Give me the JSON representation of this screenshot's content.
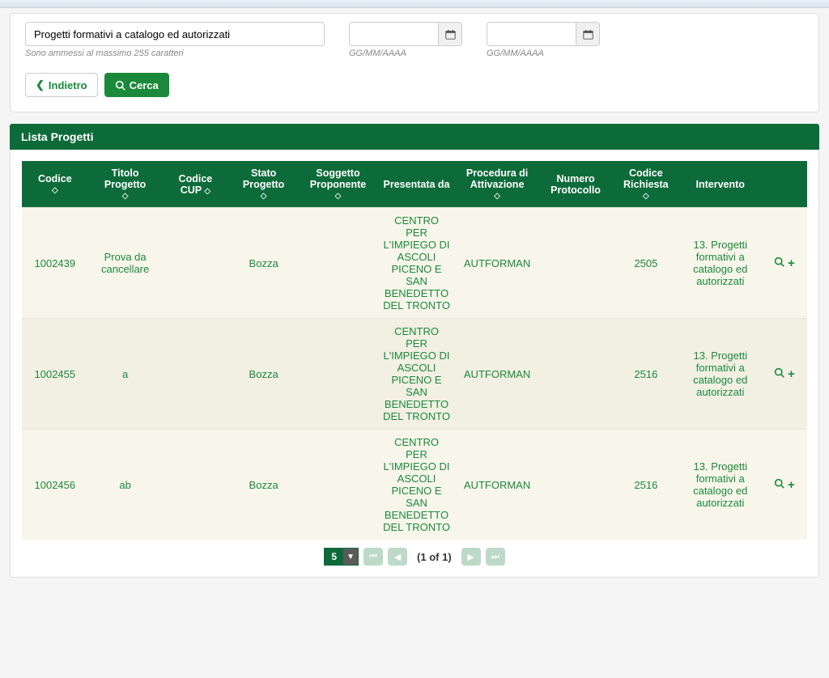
{
  "search": {
    "text_value": "Progetti formativi a catalogo ed autorizzati",
    "text_helper": "Sono ammessi al massimo 255 caratteri",
    "date_helper": "GG/MM/AAAA",
    "btn_back": "Indietro",
    "btn_search": "Cerca"
  },
  "list": {
    "title": "Lista Progetti",
    "headers": {
      "codice": "Codice",
      "titolo": "Titolo Progetto",
      "cup": "Codice CUP",
      "stato": "Stato Progetto",
      "soggetto": "Soggetto Proponente",
      "presentata": "Presentata da",
      "procedura": "Procedura di Attivazione",
      "protocollo": "Numero Protocollo",
      "richiesta": "Codice Richiesta",
      "intervento": "Intervento"
    },
    "rows": [
      {
        "codice": "1002439",
        "titolo": "Prova da cancellare",
        "cup": "",
        "stato": "Bozza",
        "soggetto": "",
        "presentata": "CENTRO PER L'IMPIEGO DI ASCOLI PICENO E SAN BENEDETTO DEL TRONTO",
        "procedura": "AUTFORMAN",
        "protocollo": "",
        "richiesta": "2505",
        "intervento": "13. Progetti formativi a catalogo ed autorizzati"
      },
      {
        "codice": "1002455",
        "titolo": "a",
        "cup": "",
        "stato": "Bozza",
        "soggetto": "",
        "presentata": "CENTRO PER L'IMPIEGO DI ASCOLI PICENO E SAN BENEDETTO DEL TRONTO",
        "procedura": "AUTFORMAN",
        "protocollo": "",
        "richiesta": "2516",
        "intervento": "13. Progetti formativi a catalogo ed autorizzati"
      },
      {
        "codice": "1002456",
        "titolo": "ab",
        "cup": "",
        "stato": "Bozza",
        "soggetto": "",
        "presentata": "CENTRO PER L'IMPIEGO DI ASCOLI PICENO E SAN BENEDETTO DEL TRONTO",
        "procedura": "AUTFORMAN",
        "protocollo": "",
        "richiesta": "2516",
        "intervento": "13. Progetti formativi a catalogo ed autorizzati"
      }
    ],
    "page_size": "5",
    "page_info": "(1 of 1)"
  }
}
